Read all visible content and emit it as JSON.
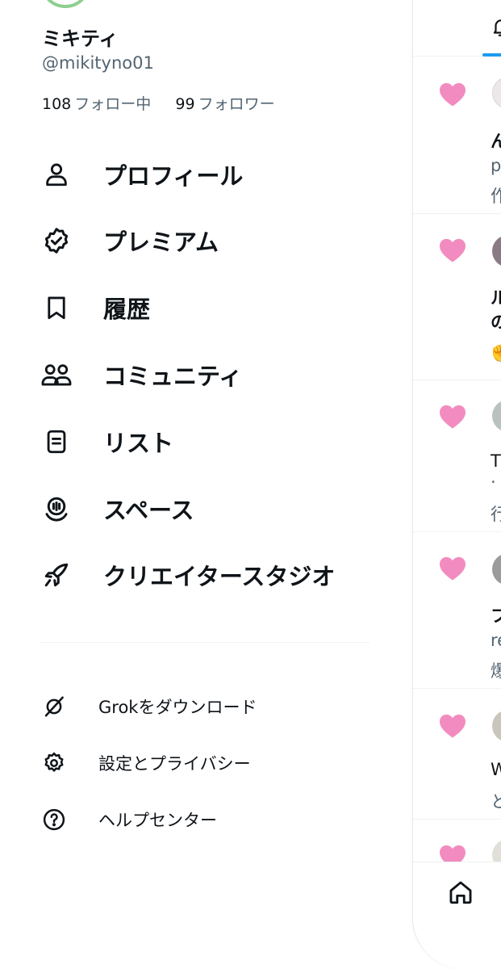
{
  "profile": {
    "display_name": "ミキティ",
    "handle": "@mikityno01",
    "following_count": "108",
    "following_label": "フォロー中",
    "followers_count": "99",
    "followers_label": "フォロワー"
  },
  "nav": {
    "items": [
      {
        "label": "プロフィール",
        "icon": "person-icon"
      },
      {
        "label": "プレミアム",
        "icon": "verified-badge-icon"
      },
      {
        "label": "履歴",
        "icon": "bookmark-icon"
      },
      {
        "label": "コミュニティ",
        "icon": "communities-icon"
      },
      {
        "label": "リスト",
        "icon": "list-icon"
      },
      {
        "label": "スペース",
        "icon": "spaces-icon"
      },
      {
        "label": "クリエイタースタジオ",
        "icon": "rocket-icon"
      }
    ]
  },
  "secondary": {
    "items": [
      {
        "label": "Grokをダウンロード",
        "icon": "grok-icon"
      },
      {
        "label": "設定とプライバシー",
        "icon": "gear-icon"
      },
      {
        "label": "ヘルプセンター",
        "icon": "help-icon"
      }
    ]
  },
  "notifications": {
    "items": [
      {
        "line1": "ん",
        "line2": "p",
        "line3": "作"
      },
      {
        "line1": "ル",
        "line2": "の",
        "line3": "✊"
      },
      {
        "line1": "T",
        "line2": "·",
        "line3": "行"
      },
      {
        "line1": "フ",
        "line2": "re",
        "line3": "爆"
      },
      {
        "line1": "W",
        "line2": "と",
        "line3": ""
      }
    ]
  },
  "colors": {
    "text_primary": "#0f1419",
    "text_secondary": "#536471",
    "like_pink": "#f28cc0",
    "accent_blue": "#1d9bf0",
    "avatar_ring": "#8dcf90",
    "divider": "#eff3f4"
  },
  "icons": {
    "notifications_tab": "bell-icon",
    "home": "home-icon",
    "like": "heart-icon"
  }
}
